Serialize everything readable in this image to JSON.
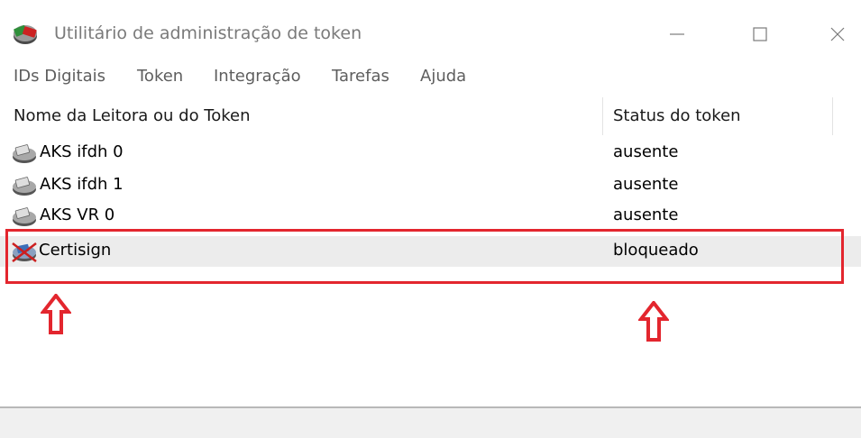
{
  "window": {
    "title": "Utilitário de administração de token"
  },
  "menu": {
    "items": [
      "IDs Digitais",
      "Token",
      "Integração",
      "Tarefas",
      "Ajuda"
    ]
  },
  "list": {
    "columns": [
      "Nome da Leitora ou do Token",
      "Status do token"
    ],
    "rows": [
      {
        "name": "AKS ifdh 0",
        "status": "ausente",
        "icon": "card-reader-icon"
      },
      {
        "name": "AKS ifdh 1",
        "status": "ausente",
        "icon": "card-reader-icon"
      },
      {
        "name": "AKS VR 0",
        "status": "ausente",
        "icon": "card-reader-icon"
      },
      {
        "name": "Certisign",
        "status": "bloqueado",
        "icon": "blocked-token-icon"
      }
    ]
  },
  "colors": {
    "highlight": "#e3262e",
    "selected_row": "#ececec"
  }
}
